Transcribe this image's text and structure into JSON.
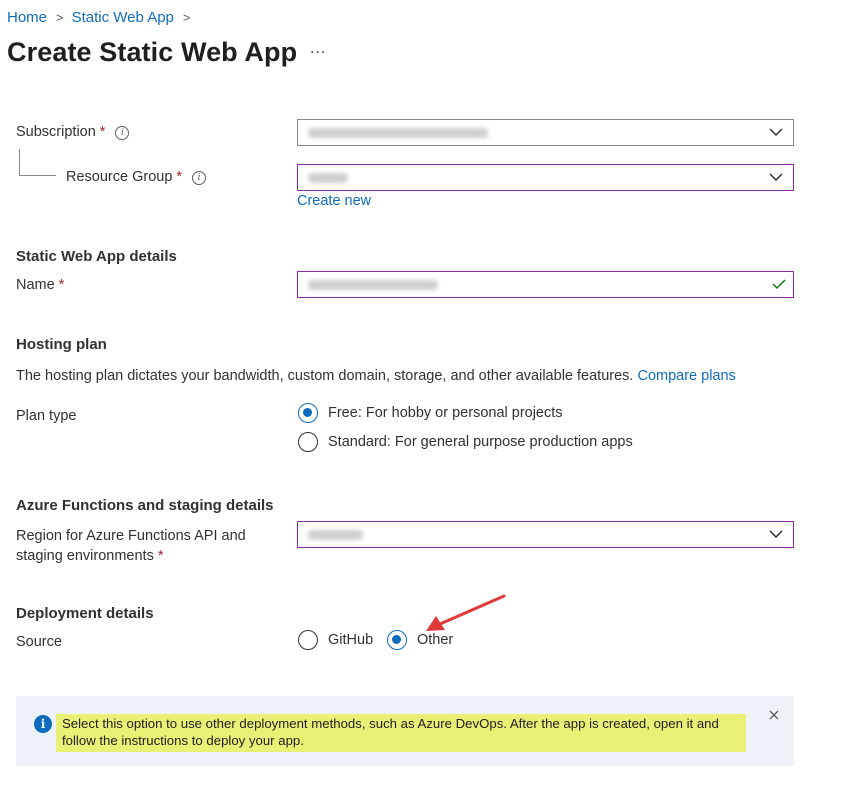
{
  "breadcrumb": {
    "home": "Home",
    "parent": "Static Web App",
    "separator": ">"
  },
  "header": {
    "title": "Create Static Web App",
    "more": "..."
  },
  "project": {
    "subscription_label": "Subscription",
    "resource_group_label": "Resource Group",
    "required_marker": "*",
    "create_new": "Create new"
  },
  "details": {
    "title": "Static Web App details",
    "name_label": "Name"
  },
  "hosting": {
    "title": "Hosting plan",
    "description": "The hosting plan dictates your bandwidth, custom domain, storage, and other available features.",
    "compare_link": "Compare plans",
    "plan_type_label": "Plan type",
    "options": [
      {
        "label": "Free: For hobby or personal projects",
        "selected": true
      },
      {
        "label": "Standard: For general purpose production apps",
        "selected": false
      }
    ]
  },
  "functions": {
    "title": "Azure Functions and staging details",
    "region_label_line1": "Region for Azure Functions API and",
    "region_label_line2": "staging environments"
  },
  "deployment": {
    "title": "Deployment details",
    "source_label": "Source",
    "options": [
      {
        "label": "GitHub",
        "selected": false
      },
      {
        "label": "Other",
        "selected": true
      }
    ]
  },
  "info_bar": {
    "line1": "Select this option to use other deployment methods, such as Azure DevOps. After the app is created, open it and",
    "line2": "follow the instructions to deploy your app."
  },
  "icons": {
    "info": "info-icon",
    "chevron": "chevron-down-icon",
    "check": "checkmark-icon",
    "close": "close-icon",
    "annotation": "red-arrow"
  },
  "colors": {
    "accent": "#0f6cbd",
    "focus_border": "#8c2f9f",
    "valid": "#107c10",
    "info_background": "#eef3fa",
    "highlight": "#e8f075",
    "annotation": "#e03a3a"
  }
}
